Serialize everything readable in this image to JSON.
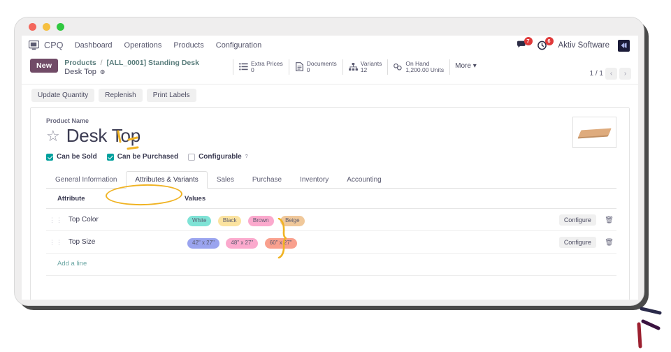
{
  "window": {
    "traffic_lights": [
      "close",
      "minimize",
      "maximize"
    ]
  },
  "navbar": {
    "brand": "CPQ",
    "brand_icon": "monitor-icon",
    "items": [
      {
        "label": "Dashboard"
      },
      {
        "label": "Operations"
      },
      {
        "label": "Products"
      },
      {
        "label": "Configuration"
      }
    ],
    "messages_badge": "7",
    "activities_badge": "6",
    "user_name": "Aktiv Software",
    "user_avatar_icon": "company-logo-icon"
  },
  "control_panel": {
    "new_button": "New",
    "breadcrumb_root": "Products",
    "breadcrumb_separator": "/",
    "breadcrumb_parent": "[ALL_0001] Standing Desk",
    "breadcrumb_current": "Desk Top",
    "gear_icon": "gear-icon",
    "stat_buttons": [
      {
        "icon": "list-icon",
        "label": "Extra Prices",
        "value": "0"
      },
      {
        "icon": "document-icon",
        "label": "Documents",
        "value": "0"
      },
      {
        "icon": "sitemap-icon",
        "label": "Variants",
        "value": "12"
      },
      {
        "icon": "cubes-icon",
        "label": "On Hand",
        "value": "1,200.00 Units"
      }
    ],
    "more_button": "More",
    "pager_text": "1 / 1",
    "pager_prev": "‹",
    "pager_next": "›"
  },
  "action_buttons": [
    {
      "label": "Update Quantity"
    },
    {
      "label": "Replenish"
    },
    {
      "label": "Print Labels"
    }
  ],
  "form": {
    "product_name_label": "Product Name",
    "product_name": "Desk Top",
    "favorite_icon": "star-icon",
    "product_image_icon": "desk-top-panel-image",
    "checkboxes": [
      {
        "label": "Can be Sold",
        "checked": true,
        "has_help": false
      },
      {
        "label": "Can be Purchased",
        "checked": true,
        "has_help": false
      },
      {
        "label": "Configurable",
        "checked": false,
        "has_help": true,
        "help_marker": "?"
      }
    ]
  },
  "tabs": [
    {
      "label": "General Information",
      "active": false
    },
    {
      "label": "Attributes & Variants",
      "active": true
    },
    {
      "label": "Sales",
      "active": false
    },
    {
      "label": "Purchase",
      "active": false
    },
    {
      "label": "Inventory",
      "active": false
    },
    {
      "label": "Accounting",
      "active": false
    }
  ],
  "attributes_table": {
    "headers": {
      "attribute": "Attribute",
      "values": "Values"
    },
    "rows": [
      {
        "handle_icon": "drag-handle-icon",
        "name": "Top Color",
        "values": [
          {
            "label": "White",
            "color": "#7fe3d6"
          },
          {
            "label": "Black",
            "color": "#fbe3a0"
          },
          {
            "label": "Brown",
            "color": "#fba9cd"
          },
          {
            "label": "Beige",
            "color": "#f0c89a"
          }
        ],
        "configure_label": "Configure",
        "delete_icon": "trash-icon"
      },
      {
        "handle_icon": "drag-handle-icon",
        "name": "Top Size",
        "values": [
          {
            "label": "42\" x 27\"",
            "color": "#9aa4ef"
          },
          {
            "label": "48\" x 27\"",
            "color": "#fba9cd"
          },
          {
            "label": "60\" x 27\"",
            "color": "#f9a08e"
          }
        ],
        "configure_label": "Configure",
        "delete_icon": "trash-icon"
      }
    ],
    "add_line_label": "Add a line"
  },
  "annotations": {
    "highlight_color": "#f0b323",
    "tab_circle_target": "Attributes & Variants",
    "brace_target": "attribute values",
    "sparkle_target": "Desk Top"
  }
}
